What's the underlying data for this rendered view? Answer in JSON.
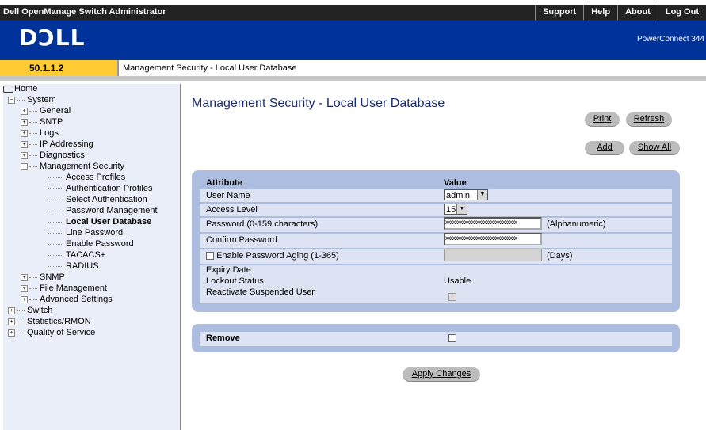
{
  "header": {
    "app_title": "Dell OpenManage Switch Administrator",
    "links": [
      "Support",
      "Help",
      "About",
      "Log Out"
    ],
    "logo": "DƆLL",
    "product": "PowerConnect 344"
  },
  "ip_address": "50.1.1.2",
  "breadcrumb": "Management Security - Local User Database",
  "tree": {
    "home": "Home",
    "system": "System",
    "general": "General",
    "sntp": "SNTP",
    "logs": "Logs",
    "ip_addressing": "IP Addressing",
    "diagnostics": "Diagnostics",
    "management_security": "Management Security",
    "access_profiles": "Access Profiles",
    "authentication_profiles": "Authentication Profiles",
    "select_authentication": "Select Authentication",
    "password_management": "Password Management",
    "local_user_database": "Local User Database",
    "line_password": "Line Password",
    "enable_password": "Enable Password",
    "tacacs": "TACACS+",
    "radius": "RADIUS",
    "snmp": "SNMP",
    "file_management": "File Management",
    "advanced_settings": "Advanced Settings",
    "switch": "Switch",
    "statistics_rmon": "Statistics/RMON",
    "qos": "Quality of Service"
  },
  "page": {
    "title": "Management Security - Local User Database",
    "print": "Print",
    "refresh": "Refresh",
    "add": "Add",
    "show_all": "Show All",
    "apply": "Apply Changes"
  },
  "form": {
    "attribute_header": "Attribute",
    "value_header": "Value",
    "user_name_label": "User Name",
    "user_name_value": "admin",
    "access_level_label": "Access Level",
    "access_level_value": "15",
    "password_label": "Password (0-159 characters)",
    "password_mask": "xxxxxxxxxxxxxxxxxxxxxxxxxxxxxx",
    "password_note": "(Alphanumeric)",
    "confirm_label": "Confirm Password",
    "confirm_mask": "xxxxxxxxxxxxxxxxxxxxxxxxxxxxxx",
    "aging_label": "Enable Password Aging (1-365)",
    "aging_note": "(Days)",
    "expiry_label": "Expiry Date",
    "lockout_label": "Lockout Status",
    "lockout_value": "Usable",
    "reactivate_label": "Reactivate Suspended User",
    "remove_label": "Remove"
  }
}
